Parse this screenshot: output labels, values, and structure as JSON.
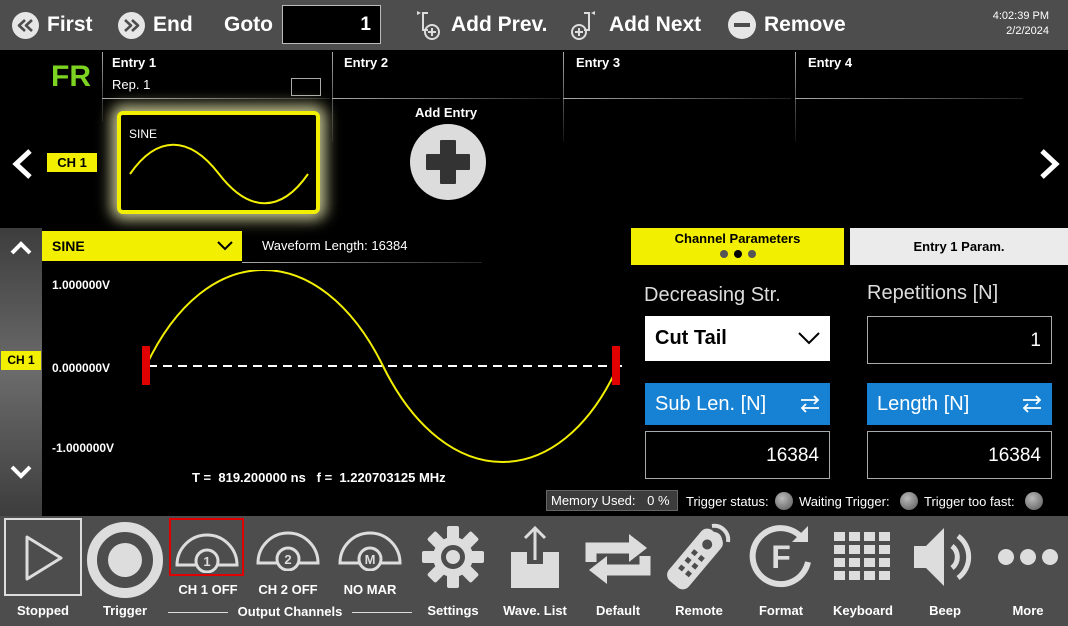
{
  "toolbar": {
    "first_label": "First",
    "end_label": "End",
    "goto_label": "Goto",
    "goto_value": "1",
    "add_prev_label": "Add Prev.",
    "add_next_label": "Add Next",
    "remove_label": "Remove",
    "clock_time": "4:02:39 PM",
    "clock_date": "2/2/2024"
  },
  "entries": {
    "mode": "FR",
    "channel_tag": "CH 1",
    "entry1_label": "Entry  1",
    "entry1_rep": "Rep.  1",
    "entry2_label": "Entry  2",
    "entry3_label": "Entry  3",
    "entry4_label": "Entry  4",
    "thumb_waveform": "SINE",
    "add_entry_label": "Add Entry"
  },
  "waveform": {
    "selected": "SINE",
    "length_text": "Waveform Length:  16384",
    "channel_tag": "CH 1",
    "v_max": "1.000000V",
    "v_mid": "0.000000V",
    "v_min": "-1.000000V",
    "period_text": "T =  819.200000 ns   f =  1.220703125 MHz"
  },
  "params": {
    "tab_channel": "Channel Parameters",
    "tab_entry": "Entry  1  Param.",
    "decreasing_label": "Decreasing Str.",
    "decreasing_value": "Cut Tail",
    "repetitions_label": "Repetitions [N]",
    "repetitions_value": "1",
    "sub_len_label": "Sub Len. [N]",
    "sub_len_value": "16384",
    "length_label": "Length [N]",
    "length_value": "16384"
  },
  "status": {
    "memory_label": "Memory Used:",
    "memory_value": "0 %",
    "trigger_status": "Trigger status:",
    "waiting_trigger": "Waiting Trigger:",
    "trigger_too_fast": "Trigger too fast:"
  },
  "bottom": {
    "stopped": "Stopped",
    "trigger": "Trigger",
    "ch1": "CH 1 OFF",
    "ch2": "CH 2 OFF",
    "mar": "NO MAR",
    "output_channels": "Output Channels",
    "settings": "Settings",
    "wave_list": "Wave. List",
    "default": "Default",
    "remote": "Remote",
    "format": "Format",
    "keyboard": "Keyboard",
    "beep": "Beep",
    "more": "More",
    "ch1_num": "1",
    "ch2_num": "2",
    "mar_letter": "M"
  },
  "colors": {
    "accent_yellow": "#f2ef00",
    "accent_blue": "#1782d4",
    "marker_red": "#e00000",
    "toolbar_gray": "#4d4d4d",
    "mode_green": "#7dd321"
  },
  "icons": [
    "double-chevron-left-icon",
    "double-chevron-right-icon",
    "add-prev-icon",
    "add-next-icon",
    "minus-icon",
    "chevron-left-icon",
    "chevron-right-icon",
    "plus-icon",
    "chevron-up-icon",
    "chevron-down-icon",
    "play-icon",
    "record-icon",
    "channel-icon",
    "gear-icon",
    "upload-icon",
    "refresh-icon",
    "remote-icon",
    "format-icon",
    "keypad-icon",
    "speaker-icon",
    "more-icon"
  ]
}
